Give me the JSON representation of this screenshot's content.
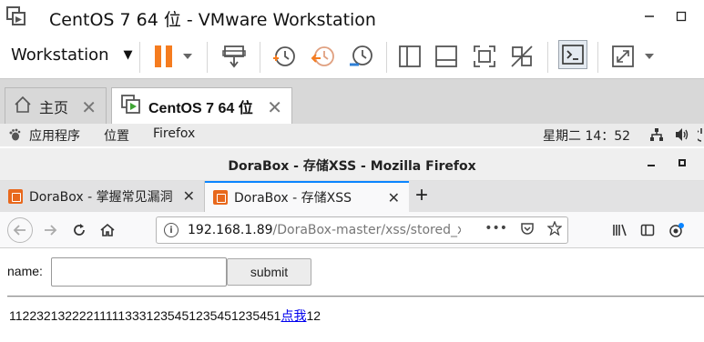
{
  "vmware": {
    "window_title": "CentOS 7 64 位 - VMware Workstation",
    "menu_label": "Workstation",
    "tabs": [
      {
        "label": "主页"
      },
      {
        "label": "CentOS 7 64 位"
      }
    ],
    "accent_color": "#f57c1f"
  },
  "gnome": {
    "apps_label": "应用程序",
    "places_label": "位置",
    "firefox_label": "Firefox",
    "clock": "星期二 14：52"
  },
  "firefox": {
    "window_title": "DoraBox - 存储XSS - Mozilla Firefox",
    "tabs": [
      {
        "label": "DoraBox - 掌握常见漏洞"
      },
      {
        "label": "DoraBox - 存储XSS"
      }
    ],
    "url_host": "192.168.1.89",
    "url_path": "/DoraBox-master/xss/stored_xss.p",
    "url_more": "•••",
    "active_tab_color": "#0a84ff"
  },
  "page": {
    "name_label": "name:",
    "name_value": "",
    "submit_label": "submit",
    "stored_text": "112232132222111113331235451235451235451",
    "stored_link": "点我",
    "stored_suffix": "12"
  }
}
